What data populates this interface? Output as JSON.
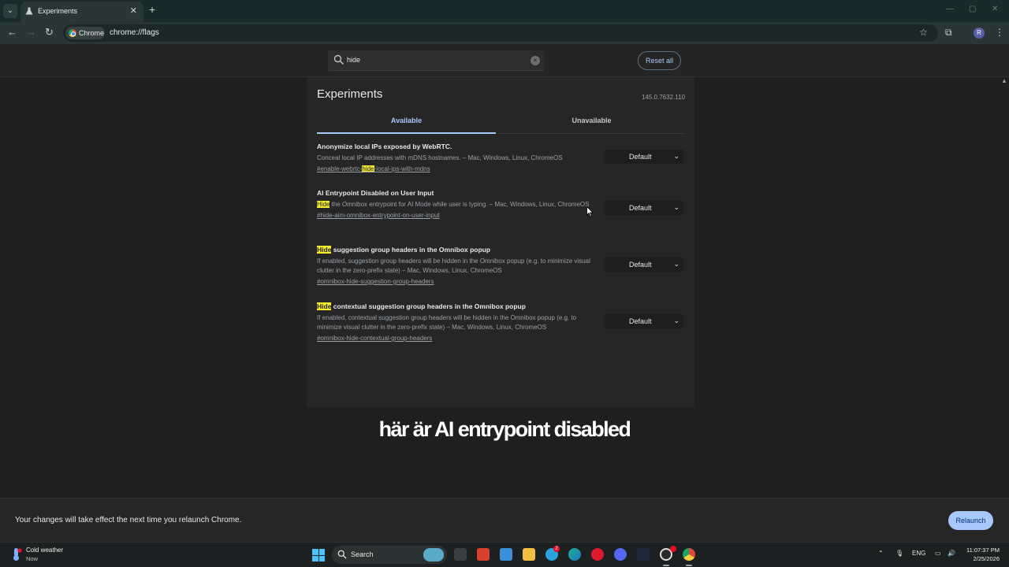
{
  "browser": {
    "tab_title": "Experiments",
    "chip_label": "Chrome",
    "url": "chrome://flags",
    "avatar_initial": "R"
  },
  "flags": {
    "search_value": "hide",
    "reset_label": "Reset all",
    "title": "Experiments",
    "version": "145.0.7632.110",
    "tabs": [
      {
        "label": "Available",
        "active": true
      },
      {
        "label": "Unavailable",
        "active": false
      }
    ],
    "highlight_color": "#f5ee2e",
    "accent_color": "#a8c7fa",
    "experiments": [
      {
        "title_pre": "",
        "title_mark": "",
        "title_post": "Anonymize local IPs exposed by WebRTC.",
        "desc_mark": "",
        "desc_post": "Conceal local IP addresses with mDNS hostnames. – Mac, Windows, Linux, ChromeOS",
        "link_pre": "#enable-webrtc-",
        "link_mark": "hide",
        "link_post": "-local-ips-with-mdns",
        "value": "Default"
      },
      {
        "title_pre": "",
        "title_mark": "",
        "title_post": "AI Entrypoint Disabled on User Input",
        "desc_mark": "Hide",
        "desc_post": " the Omnibox entrypoint for AI Mode while user is typing. – Mac, Windows, Linux, ChromeOS",
        "link_pre": "#hide-aim-omnibox-entrypoint-on-user-input",
        "link_mark": "",
        "link_post": "",
        "value": "Default"
      },
      {
        "title_pre": "",
        "title_mark": "Hide",
        "title_post": " suggestion group headers in the Omnibox popup",
        "desc_mark": "",
        "desc_post": "If enabled, suggestion group headers will be hidden in the Omnibox popup (e.g. to minimize visual clutter in the zero-prefix state) – Mac, Windows, Linux, ChromeOS",
        "link_pre": "#omnibox-hide-suggestion-group-headers",
        "link_mark": "",
        "link_post": "",
        "value": "Default"
      },
      {
        "title_pre": "",
        "title_mark": "Hide",
        "title_post": " contextual suggestion group headers in the Omnibox popup",
        "desc_mark": "",
        "desc_post": "If enabled, contextual suggestion group headers will be hidden in the Omnibox popup (e.g. to minimize visual clutter in the zero-prefix state) – Mac, Windows, Linux, ChromeOS",
        "link_pre": "#omnibox-hide-contextual-group-headers",
        "link_mark": "",
        "link_post": "",
        "value": "Default"
      }
    ],
    "relaunch_text": "Your changes will take effect the next time you relaunch Chrome.",
    "relaunch_label": "Relaunch"
  },
  "caption": "här är AI entrypoint disabled",
  "taskbar": {
    "weather_title": "Cold weather",
    "weather_sub": "Now",
    "search_label": "Search",
    "telegram_badge": "2",
    "language": "ENG",
    "time": "11:07:37 PM",
    "date": "2/25/2026",
    "apps": [
      "task-view",
      "video-editor",
      "notepad",
      "file-explorer",
      "telegram",
      "edge",
      "opera",
      "discord",
      "steam",
      "obs",
      "chrome"
    ]
  }
}
